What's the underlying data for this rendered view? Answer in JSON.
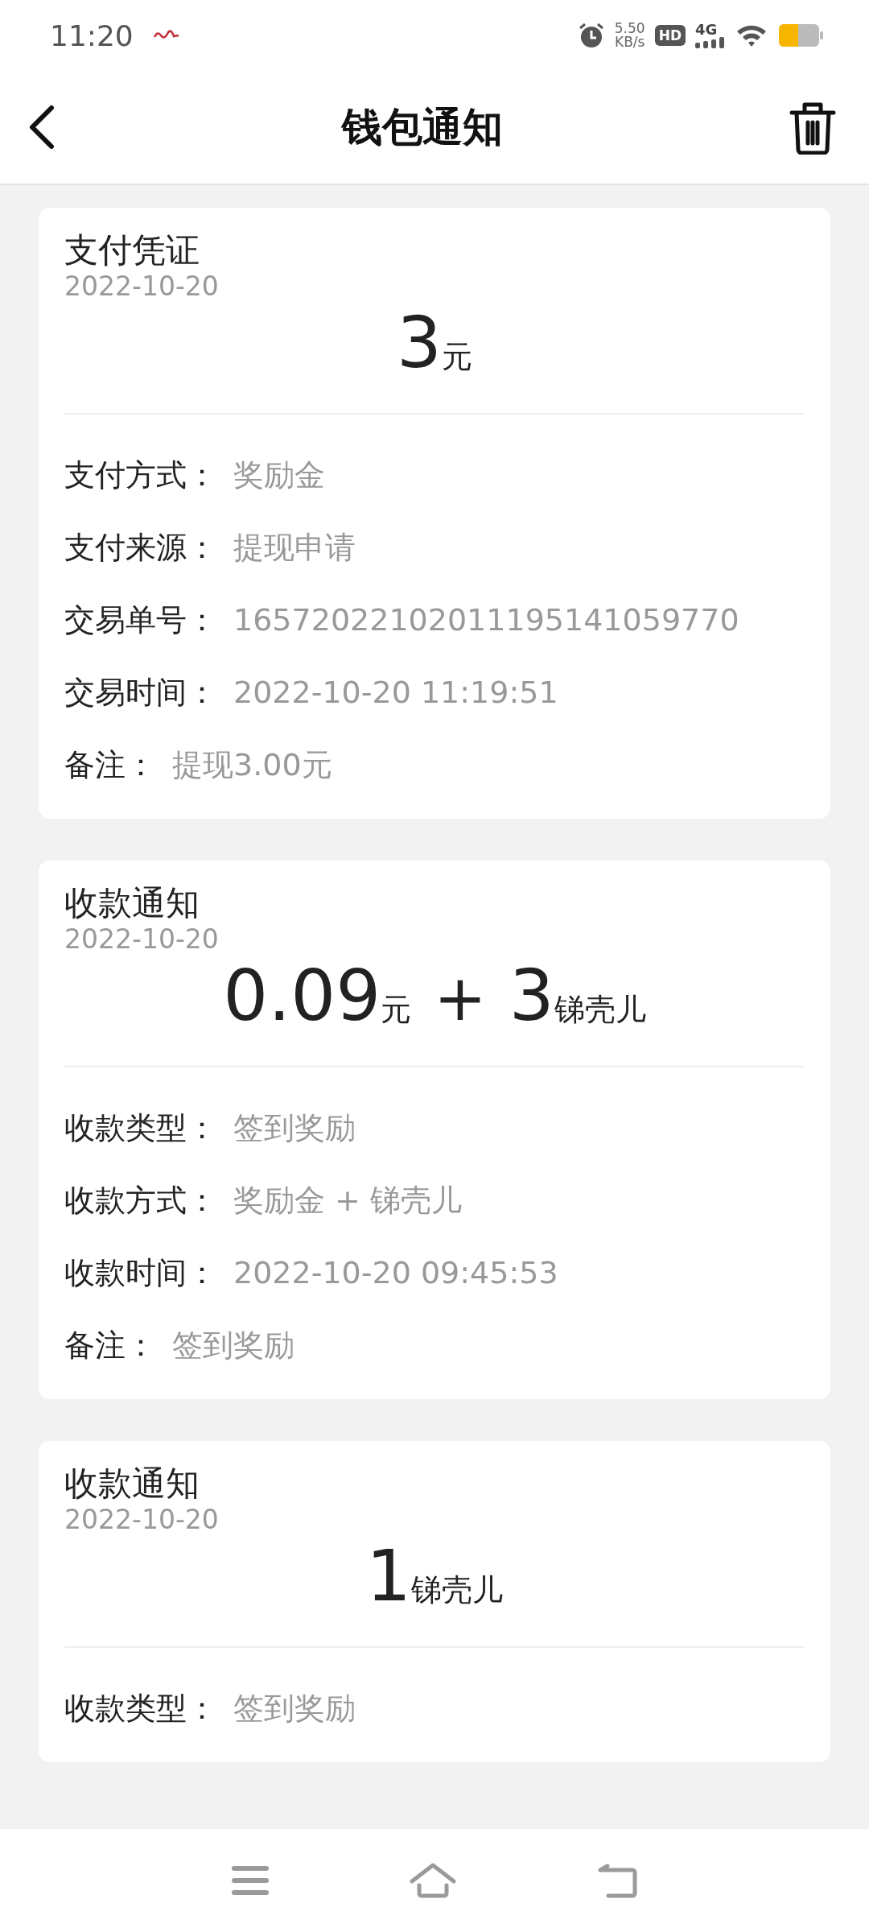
{
  "status_bar": {
    "time": "11:20",
    "speed_value": "5.50",
    "speed_unit": "KB/s",
    "hd_badge": "HD",
    "network": "4G"
  },
  "header": {
    "title": "钱包通知"
  },
  "notices": [
    {
      "title": "支付凭证",
      "date": "2022-10-20",
      "amount": [
        {
          "kind": "number",
          "text": "3"
        },
        {
          "kind": "unit",
          "text": "元"
        }
      ],
      "rows": [
        {
          "label": "支付方式：",
          "value": "奖励金"
        },
        {
          "label": "支付来源：",
          "value": "提现申请"
        },
        {
          "label": "交易单号：",
          "value": "16572022102011195141059770"
        },
        {
          "label": "交易时间：",
          "value": "2022-10-20 11:19:51"
        },
        {
          "label": "备注：",
          "value": "提现3.00元"
        }
      ]
    },
    {
      "title": "收款通知",
      "date": "2022-10-20",
      "amount": [
        {
          "kind": "number",
          "text": "0.09"
        },
        {
          "kind": "unit",
          "text": "元"
        },
        {
          "kind": "operator",
          "text": "+"
        },
        {
          "kind": "number",
          "text": "3"
        },
        {
          "kind": "unit",
          "text": "锑壳儿"
        }
      ],
      "rows": [
        {
          "label": "收款类型：",
          "value": "签到奖励"
        },
        {
          "label": "收款方式：",
          "value": "奖励金 + 锑壳儿"
        },
        {
          "label": "收款时间：",
          "value": "2022-10-20 09:45:53"
        },
        {
          "label": "备注：",
          "value": "签到奖励"
        }
      ]
    },
    {
      "title": "收款通知",
      "date": "2022-10-20",
      "amount": [
        {
          "kind": "number",
          "text": "1"
        },
        {
          "kind": "unit",
          "text": "锑壳儿"
        }
      ],
      "rows": [
        {
          "label": "收款类型：",
          "value": "签到奖励"
        }
      ]
    }
  ]
}
